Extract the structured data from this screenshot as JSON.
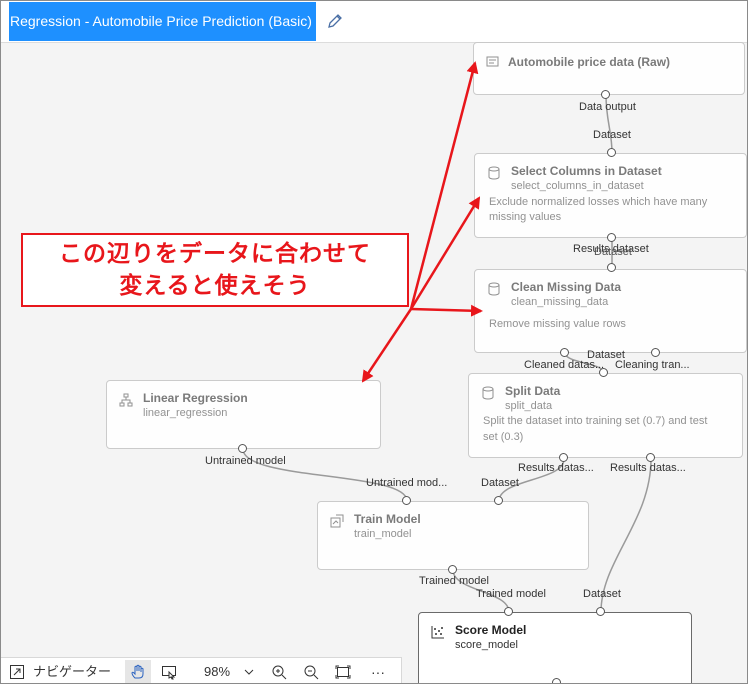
{
  "header": {
    "title": "Regression - Automobile Price Prediction (Basic)"
  },
  "nodes": {
    "raw": {
      "title": "Automobile price data (Raw)"
    },
    "select": {
      "title": "Select Columns in Dataset",
      "sub": "select_columns_in_dataset",
      "desc1": "Exclude normalized losses which have many",
      "desc2": "missing values"
    },
    "clean": {
      "title": "Clean Missing Data",
      "sub": "clean_missing_data",
      "desc1": "Remove missing value rows"
    },
    "split": {
      "title": "Split Data",
      "sub": "split_data",
      "desc1": "Split the dataset into training set (0.7) and test",
      "desc2": "set (0.3)"
    },
    "linear": {
      "title": "Linear Regression",
      "sub": "linear_regression"
    },
    "train": {
      "title": "Train Model",
      "sub": "train_model"
    },
    "score": {
      "title": "Score Model",
      "sub": "score_model"
    }
  },
  "ports": {
    "raw_out": "Data output",
    "select_in": "Dataset",
    "select_out": "Results dataset",
    "clean_in": "Dataset",
    "clean_out1": "Cleaned datas...",
    "clean_out2": "Cleaning tran...",
    "split_in": "Dataset",
    "split_out1": "Results datas...",
    "split_out2": "Results datas...",
    "linear_out": "Untrained model",
    "train_in1": "Untrained mod...",
    "train_in2": "Dataset",
    "train_out": "Trained model",
    "score_in1": "Trained model",
    "score_in2": "Dataset"
  },
  "callout": {
    "line1": "この辺りをデータに合わせて",
    "line2": "変えると使えそう",
    "color": "#e8161b"
  },
  "toolbar": {
    "navigator": "ナビゲーター",
    "zoom": "98%",
    "more": "···"
  },
  "colors": {
    "title_bg": "#1e90ff",
    "annotation": "#e8161b"
  }
}
